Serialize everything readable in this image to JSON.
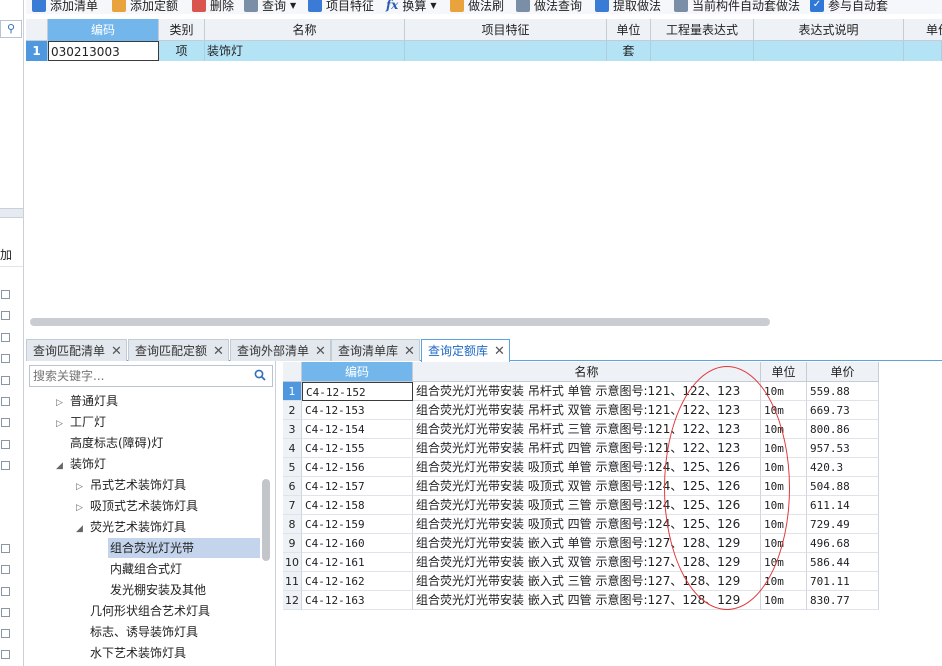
{
  "toolbar": {
    "add_list": "添加清单",
    "add_quota": "添加定额",
    "delete": "删除",
    "query": "查询",
    "item_feature": "项目特征",
    "fx": "fx",
    "convert": "换算",
    "method_brush": "做法刷",
    "method_query": "做法查询",
    "extract_method": "提取做法",
    "auto_apply": "当前构件自动套做法",
    "participate_auto": "参与自动套"
  },
  "left_strip": {
    "search_icon": "search-icon",
    "add_label": "加"
  },
  "top_grid": {
    "columns": [
      "编码",
      "类别",
      "名称",
      "项目特征",
      "单位",
      "工程量表达式",
      "表达式说明",
      "单价"
    ],
    "row": {
      "num": "1",
      "code": "030213003",
      "type": "项",
      "name": "装饰灯",
      "feature": "",
      "unit": "套",
      "expr": "",
      "expr_desc": "",
      "price": ""
    }
  },
  "tabs": [
    {
      "label": "查询匹配清单"
    },
    {
      "label": "查询匹配定额"
    },
    {
      "label": "查询外部清单"
    },
    {
      "label": "查询清单库"
    },
    {
      "label": "查询定额库"
    }
  ],
  "search": {
    "placeholder": "搜索关键字..."
  },
  "tree": [
    {
      "label": "普通灯具",
      "arrow": "▷"
    },
    {
      "label": "工厂灯",
      "arrow": "▷"
    },
    {
      "label": "高度标志(障碍)灯",
      "arrow": ""
    },
    {
      "label": "装饰灯",
      "arrow": "◢"
    },
    {
      "label": "吊式艺术装饰灯具",
      "arrow": "▷"
    },
    {
      "label": "吸顶式艺术装饰灯具",
      "arrow": "▷"
    },
    {
      "label": "荧光艺术装饰灯具",
      "arrow": "◢"
    },
    {
      "label": "组合荧光灯光带",
      "arrow": ""
    },
    {
      "label": "内藏组合式灯",
      "arrow": ""
    },
    {
      "label": "发光棚安装及其他",
      "arrow": ""
    },
    {
      "label": "几何形状组合艺术灯具",
      "arrow": ""
    },
    {
      "label": "标志、诱导装饰灯具",
      "arrow": ""
    },
    {
      "label": "水下艺术装饰灯具",
      "arrow": ""
    }
  ],
  "quota_grid": {
    "columns": [
      "编码",
      "名称",
      "单位",
      "单价"
    ],
    "rows": [
      {
        "n": "1",
        "code": "C4-12-152",
        "name": "组合荧光灯光带安装 吊杆式 单管 示意图号:121、122、123",
        "unit": "10m",
        "price": "559.88"
      },
      {
        "n": "2",
        "code": "C4-12-153",
        "name": "组合荧光灯光带安装 吊杆式 双管 示意图号:121、122、123",
        "unit": "10m",
        "price": "669.73"
      },
      {
        "n": "3",
        "code": "C4-12-154",
        "name": "组合荧光灯光带安装 吊杆式 三管 示意图号:121、122、123",
        "unit": "10m",
        "price": "800.86"
      },
      {
        "n": "4",
        "code": "C4-12-155",
        "name": "组合荧光灯光带安装 吊杆式 四管 示意图号:121、122、123",
        "unit": "10m",
        "price": "957.53"
      },
      {
        "n": "5",
        "code": "C4-12-156",
        "name": "组合荧光灯光带安装 吸顶式 单管 示意图号:124、125、126",
        "unit": "10m",
        "price": "420.3"
      },
      {
        "n": "6",
        "code": "C4-12-157",
        "name": "组合荧光灯光带安装 吸顶式 双管 示意图号:124、125、126",
        "unit": "10m",
        "price": "504.88"
      },
      {
        "n": "7",
        "code": "C4-12-158",
        "name": "组合荧光灯光带安装 吸顶式 三管 示意图号:124、125、126",
        "unit": "10m",
        "price": "611.14"
      },
      {
        "n": "8",
        "code": "C4-12-159",
        "name": "组合荧光灯光带安装 吸顶式 四管 示意图号:124、125、126",
        "unit": "10m",
        "price": "729.49"
      },
      {
        "n": "9",
        "code": "C4-12-160",
        "name": "组合荧光灯光带安装 嵌入式 单管 示意图号:127、128、129",
        "unit": "10m",
        "price": "496.68"
      },
      {
        "n": "10",
        "code": "C4-12-161",
        "name": "组合荧光灯光带安装 嵌入式 双管 示意图号:127、128、129",
        "unit": "10m",
        "price": "586.44"
      },
      {
        "n": "11",
        "code": "C4-12-162",
        "name": "组合荧光灯光带安装 嵌入式 三管 示意图号:127、128、129",
        "unit": "10m",
        "price": "701.11"
      },
      {
        "n": "12",
        "code": "C4-12-163",
        "name": "组合荧光灯光带安装 嵌入式 四管 示意图号:127、128、129",
        "unit": "10m",
        "price": "830.77"
      }
    ]
  }
}
